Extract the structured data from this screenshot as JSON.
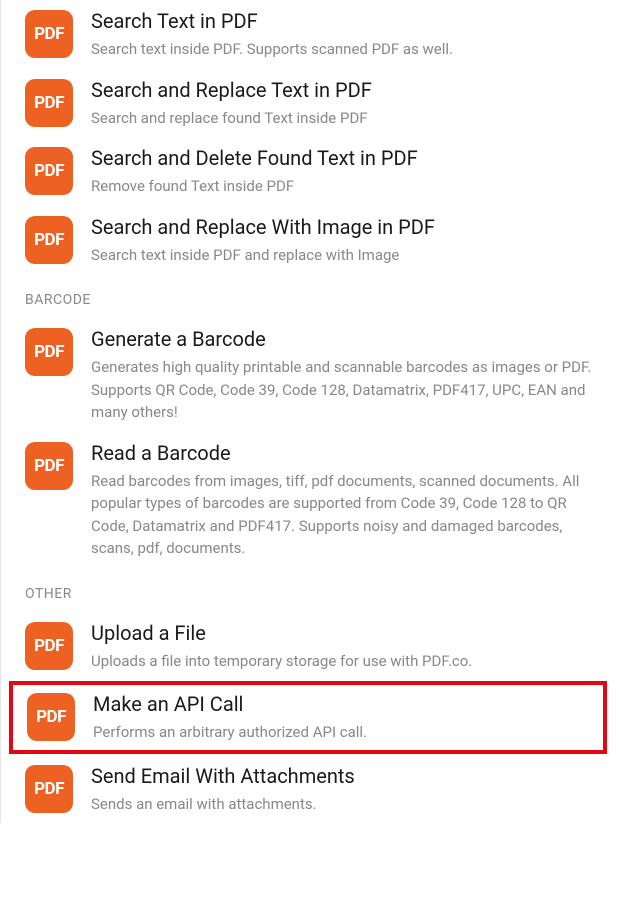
{
  "icon_label": "PDF",
  "pdf_section": {
    "items": [
      {
        "title": "Search Text in PDF",
        "desc": "Search text inside PDF. Supports scanned PDF as well."
      },
      {
        "title": "Search and Replace Text in PDF",
        "desc": "Search and replace found Text inside PDF"
      },
      {
        "title": "Search and Delete Found Text in PDF",
        "desc": "Remove found Text inside PDF"
      },
      {
        "title": "Search and Replace With Image in PDF",
        "desc": "Search text inside PDF and replace with Image"
      }
    ]
  },
  "barcode_section": {
    "header": "BARCODE",
    "items": [
      {
        "title": "Generate a Barcode",
        "desc": "Generates high quality printable and scannable barcodes as images or PDF. Supports QR Code, Code 39, Code 128, Datamatrix, PDF417, UPC, EAN and many others!"
      },
      {
        "title": "Read a Barcode",
        "desc": "Read barcodes from images, tiff, pdf documents, scanned documents. All popular types of barcodes are supported from Code 39, Code 128 to QR Code, Datamatrix and PDF417. Supports noisy and damaged barcodes, scans, pdf, documents."
      }
    ]
  },
  "other_section": {
    "header": "OTHER",
    "items": [
      {
        "title": "Upload a File",
        "desc": "Uploads a file into temporary storage for use with PDF.co."
      },
      {
        "title": "Make an API Call",
        "desc": "Performs an arbitrary authorized API call."
      },
      {
        "title": "Send Email With Attachments",
        "desc": "Sends an email with attachments."
      }
    ]
  }
}
